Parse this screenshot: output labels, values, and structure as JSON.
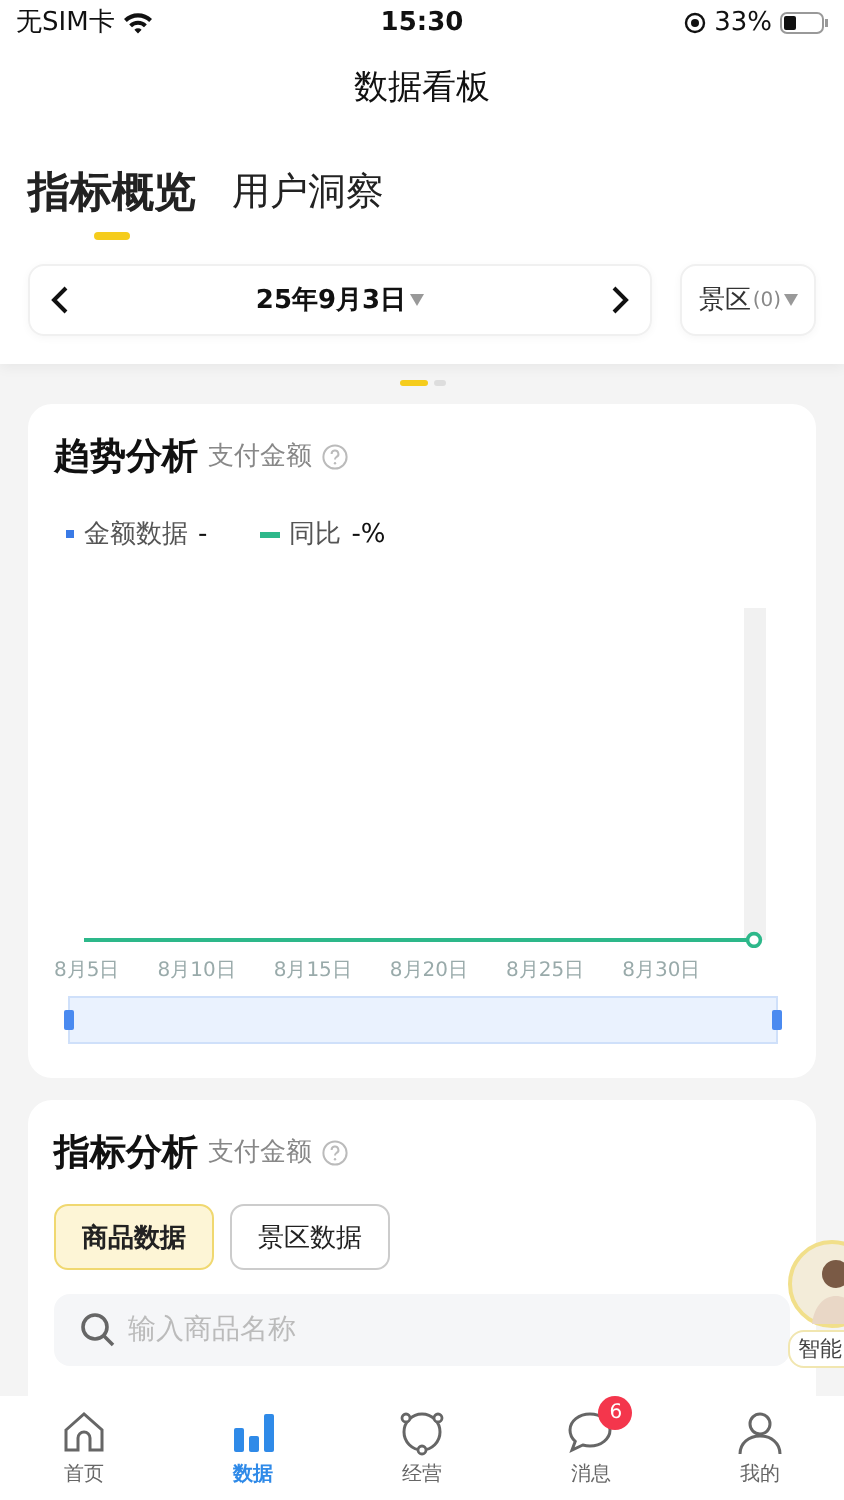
{
  "status_bar": {
    "carrier": "无SIM卡",
    "time": "15:30",
    "battery": "33%"
  },
  "title": "数据看板",
  "tabs": [
    {
      "label": "指标概览",
      "selected": true
    },
    {
      "label": "用户洞察",
      "selected": false
    }
  ],
  "date_bar": {
    "date": "25年9月3日",
    "filter": {
      "label": "景区",
      "count": "(0)"
    }
  },
  "pager": [
    {
      "selected": true
    },
    {
      "selected": false
    }
  ],
  "trend_card": {
    "title": "趋势分析",
    "subtitle": "支付金额",
    "legend": [
      {
        "kind": "dot",
        "label": "金额数据",
        "value": "-",
        "color": "#3a7ae6"
      },
      {
        "kind": "line",
        "label": "同比",
        "value": "-%",
        "color": "#2db88a"
      }
    ],
    "x_labels": [
      "8月5日",
      "8月10日",
      "8月15日",
      "8月20日",
      "8月25日",
      "8月30日"
    ],
    "range": {
      "level": 1
    }
  },
  "metric_card": {
    "title": "指标分析",
    "subtitle": "支付金额",
    "segments": [
      {
        "label": "商品数据",
        "selected": true
      },
      {
        "label": "景区数据",
        "selected": false
      }
    ],
    "search": {
      "placeholder": "输入商品名称"
    }
  },
  "assistant": {
    "label": "智能"
  },
  "nav": [
    {
      "label": "首页",
      "selected": false
    },
    {
      "label": "数据",
      "selected": true
    },
    {
      "label": "经营",
      "selected": false
    },
    {
      "label": "消息",
      "selected": false,
      "badge": "6"
    },
    {
      "label": "我的",
      "selected": false
    }
  ]
}
